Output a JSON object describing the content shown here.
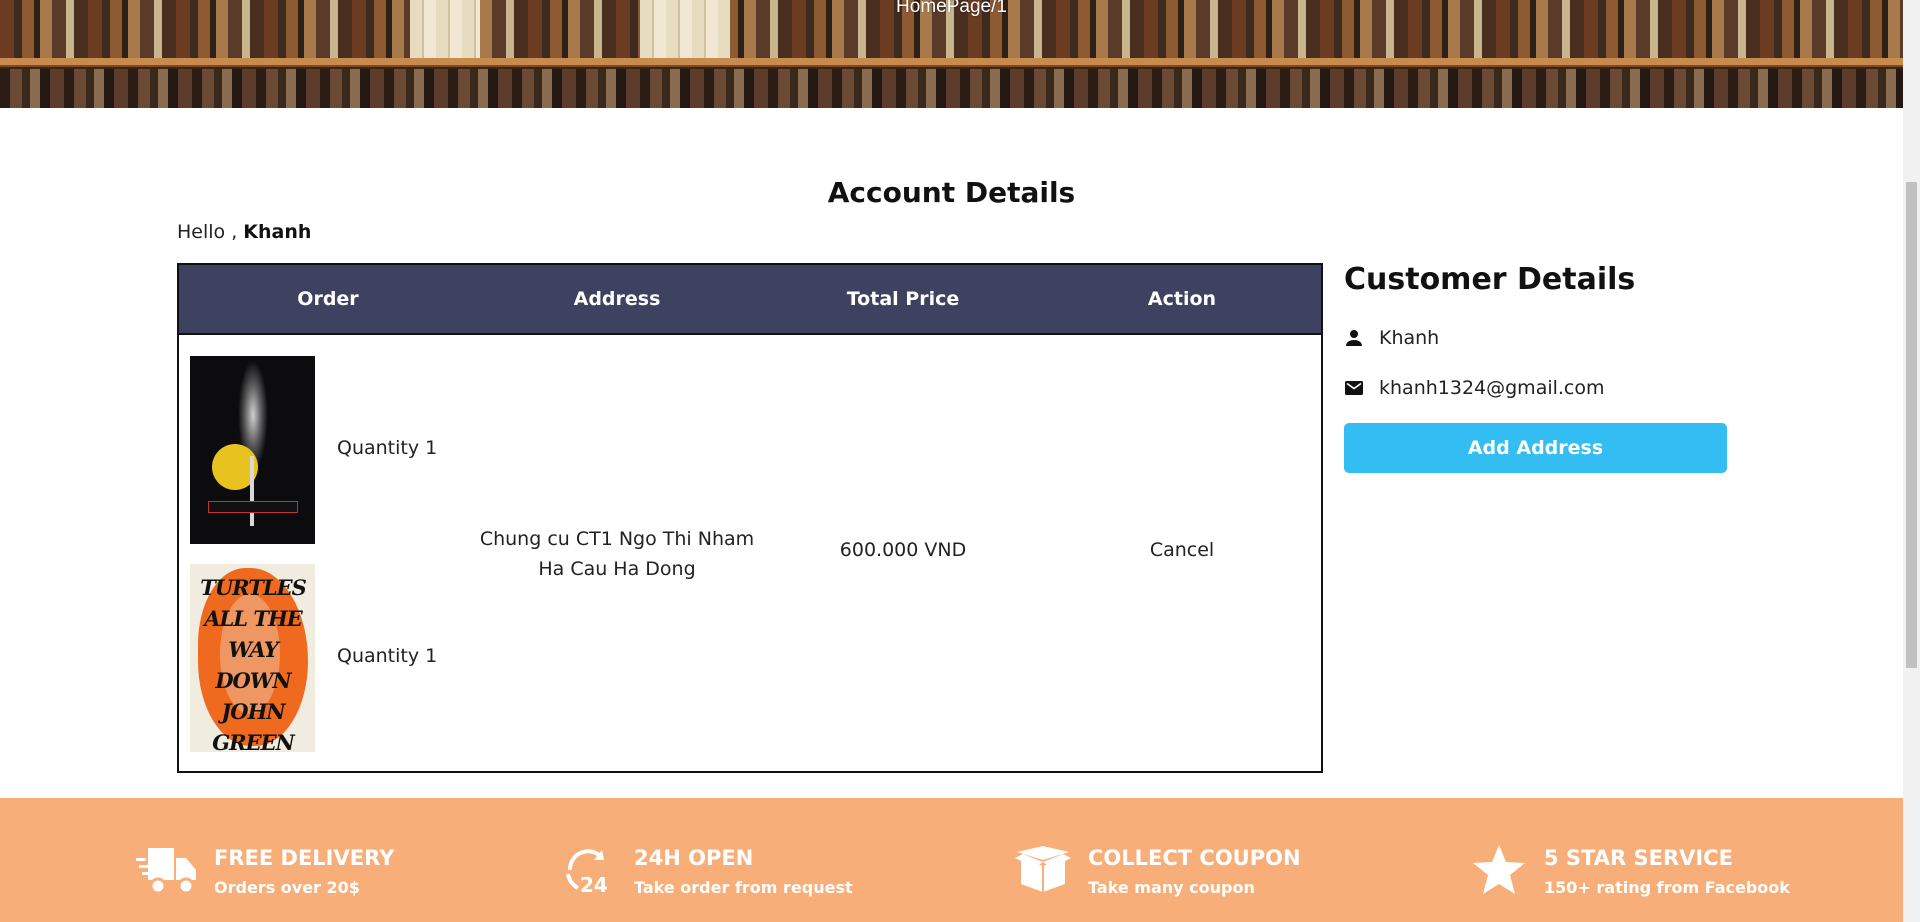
{
  "banner": {
    "breadcrumb": "HomePage/1"
  },
  "main": {
    "title": "Account Details",
    "greeting_prefix": "Hello , ",
    "username": "Khanh"
  },
  "orders": {
    "headers": [
      "Order",
      "Address",
      "Total Price",
      "Action"
    ],
    "items": [
      {
        "quantity_label": "Quantity 1",
        "cover": "looking-for-alaska-cover"
      },
      {
        "quantity_label": "Quantity 1",
        "cover": "turtles-all-the-way-down-cover",
        "cover_text": "TURTLES ALL THE WAY DOWN JOHN GREEN"
      }
    ],
    "address_line1": "Chung cu CT1 Ngo Thi Nham",
    "address_line2": "Ha Cau Ha Dong",
    "total_price": "600.000 VND",
    "action": "Cancel"
  },
  "customer": {
    "title": "Customer Details",
    "name": "Khanh",
    "email": "khanh1324@gmail.com",
    "add_address_label": "Add Address",
    "name_icon": "person-icon",
    "email_icon": "mail-icon",
    "button_color": "#33bdf2"
  },
  "features": [
    {
      "title": "FREE DELIVERY",
      "subtitle": "Orders over 20$",
      "icon": "delivery-truck-icon"
    },
    {
      "title": "24H OPEN",
      "subtitle": "Take order from request",
      "icon": "clock-24h-icon"
    },
    {
      "title": "COLLECT COUPON",
      "subtitle": "Take many coupon",
      "icon": "open-box-icon"
    },
    {
      "title": "5 STAR SERVICE",
      "subtitle": "150+ rating from Facebook",
      "icon": "star-icon"
    }
  ],
  "colors": {
    "table_header": "#3e4260",
    "features_bg": "#f7ae79"
  }
}
